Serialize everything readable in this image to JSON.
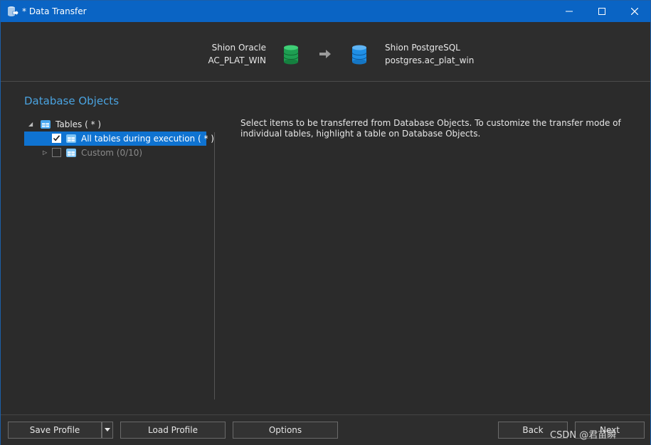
{
  "window": {
    "title": "* Data Transfer"
  },
  "connection": {
    "source_name": "Shion Oracle",
    "source_schema": "AC_PLAT_WIN",
    "target_name": "Shion PostgreSQL",
    "target_schema": "postgres.ac_plat_win",
    "source_color": "#1e9e52",
    "target_color": "#1f8fe6"
  },
  "section": {
    "title": "Database Objects"
  },
  "tree": {
    "root_label": "Tables ( * )",
    "items": [
      {
        "label": "All tables during execution ( * )",
        "checked": true,
        "selected": true
      },
      {
        "label": "Custom (0/10)",
        "checked": false,
        "selected": false
      }
    ]
  },
  "info": {
    "text": "Select items to be transferred from Database Objects. To customize the transfer mode of individual tables, highlight a table on Database Objects."
  },
  "footer": {
    "save_profile": "Save Profile",
    "load_profile": "Load Profile",
    "options": "Options",
    "back": "Back",
    "next": "Next"
  },
  "watermark": "CSDN @君苗瞬",
  "colors": {
    "accent": "#0a64c4",
    "selection": "#0f73d1",
    "section_title": "#4aa3e0"
  }
}
